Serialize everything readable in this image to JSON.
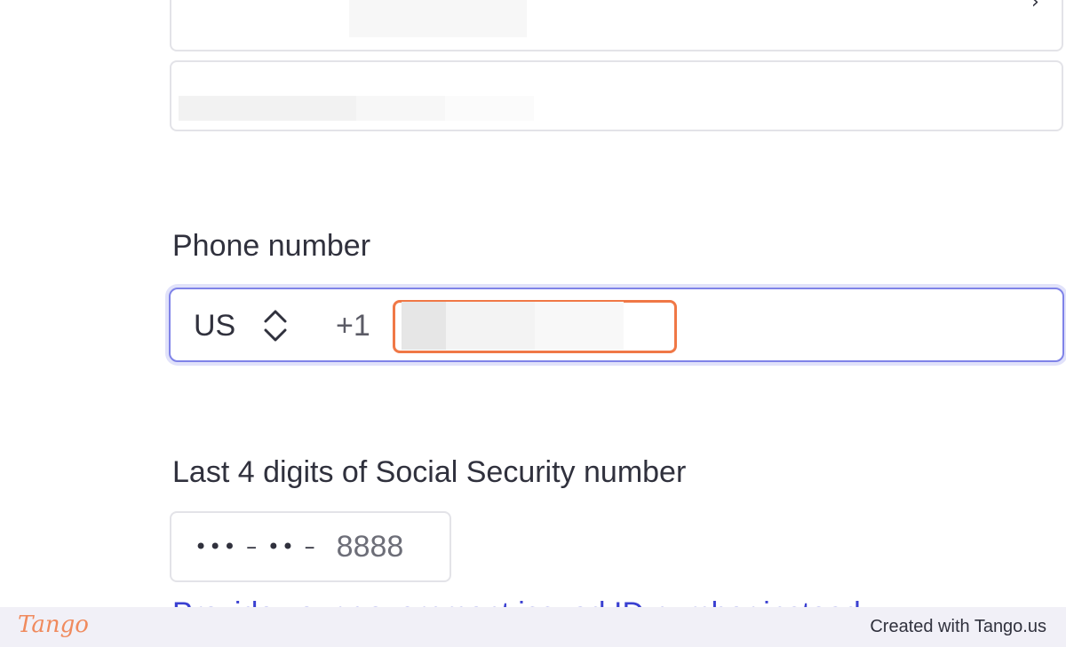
{
  "form": {
    "phone": {
      "label": "Phone number",
      "country_code": "US",
      "dial_prefix": "+1",
      "value": ""
    },
    "ssn": {
      "label": "Last 4 digits of Social Security number",
      "mask": "••• – •• –",
      "last_four": "8888"
    },
    "id_link_text": "Provide your government issued ID number instead"
  },
  "footer": {
    "logo_text": "Tango",
    "credit": "Created with Tango.us"
  },
  "colors": {
    "focus_ring": "#7f83e8",
    "highlight": "#f07846",
    "link": "#3a40d1",
    "footer_bg": "#f1f0f7",
    "brand": "#f08a5d"
  },
  "icons": {
    "country_chevron": "chevron-up-down-icon",
    "select_chevron": "chevron-right-icon"
  }
}
